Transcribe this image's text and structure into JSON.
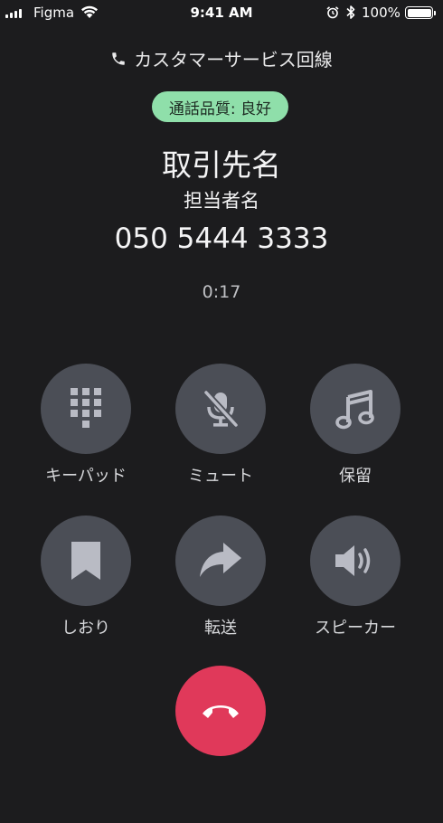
{
  "status_bar": {
    "carrier": "Figma",
    "time": "9:41 AM",
    "battery": "100%"
  },
  "call": {
    "line_label": "カスタマーサービス回線",
    "quality": "通話品質: 良好",
    "contact_name": "取引先名",
    "person_name": "担当者名",
    "phone_number": "050 5444 3333",
    "elapsed": "0:17"
  },
  "controls": [
    {
      "label": "キーパッド",
      "icon": "keypad-icon"
    },
    {
      "label": "ミュート",
      "icon": "mic-muted-icon"
    },
    {
      "label": "保留",
      "icon": "music-note-icon"
    },
    {
      "label": "しおり",
      "icon": "bookmark-icon"
    },
    {
      "label": "転送",
      "icon": "forward-arrow-icon"
    },
    {
      "label": "スピーカー",
      "icon": "speaker-icon"
    }
  ],
  "colors": {
    "background": "#1c1c1e",
    "button": "#4b4e56",
    "icon": "#b9bbc4",
    "quality_badge": "#8fdfaa",
    "end_call": "#e0395a"
  }
}
